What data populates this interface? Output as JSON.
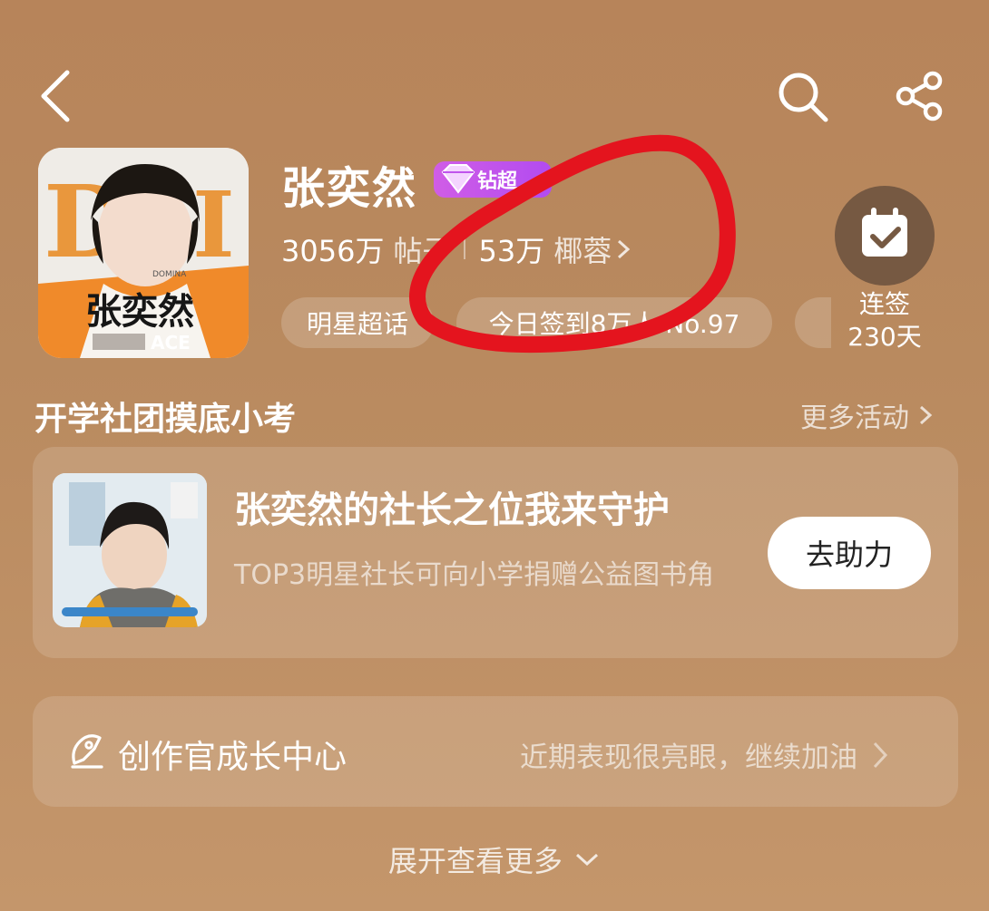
{
  "header": {
    "back_icon": "back-arrow-icon",
    "search_icon": "search-icon",
    "share_icon": "share-icon"
  },
  "profile": {
    "avatar_texts": [
      "张奕然",
      "ACE",
      "DOMINA"
    ],
    "name": "张奕然",
    "badge_label": "钻超",
    "posts_count": "3056万",
    "posts_label": "帖子",
    "fans_count": "53万",
    "fans_label": "椰蓉"
  },
  "chips": {
    "category": "明星超话",
    "today_checkin": "今日签到8万人 No.97"
  },
  "checkin": {
    "label": "连签",
    "days": "230天"
  },
  "section": {
    "title": "开学社团摸底小考",
    "more_label": "更多活动"
  },
  "activity_card": {
    "title": "张奕然的社长之位我来守护",
    "description": "TOP3明星社长可向小学捐赠公益图书角",
    "button_label": "去助力"
  },
  "creator_center": {
    "label": "创作官成长中心",
    "description": "近期表现很亮眼，继续加油"
  },
  "expand": {
    "label": "展开查看更多"
  },
  "colors": {
    "background": "#b98a5f",
    "badge": "#c054ec",
    "annotation_red": "#e4141e",
    "checkin_circle": "#765942"
  }
}
